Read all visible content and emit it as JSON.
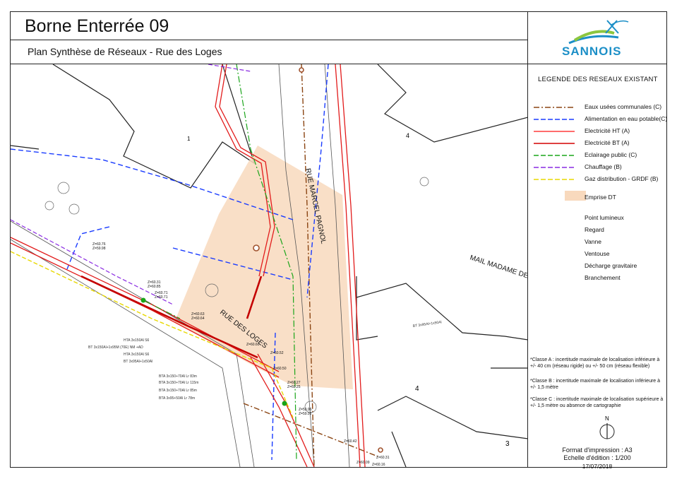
{
  "header": {
    "title": "Borne Enterrée 09",
    "subtitle": "Plan Synthèse de Réseaux - Rue des Loges",
    "logo_text": "SANNOIS"
  },
  "legend": {
    "title": "LEGENDE DES RESEAUX EXISTANT",
    "network_items": [
      {
        "label": "Eaux usées communales (C)",
        "color": "#8b4513",
        "style": "dashdot"
      },
      {
        "label": "Alimentation en eau potable(C)",
        "color": "#1a3cff",
        "style": "dash"
      },
      {
        "label": "Electricité HT (A)",
        "color": "#ff3b3b",
        "style": "solid"
      },
      {
        "label": "Electricité BT (A)",
        "color": "#d40000",
        "style": "solid"
      },
      {
        "label": "Eclairage public (C)",
        "color": "#1aa51a",
        "style": "dash"
      },
      {
        "label": "Chauffage (B)",
        "color": "#8a2be2",
        "style": "dash"
      },
      {
        "label": "Gaz distribution - GRDF (B)",
        "color": "#e8d800",
        "style": "dash"
      }
    ],
    "emprise": {
      "label": "Emprise DT",
      "color": "#f8d9bd"
    },
    "symbol_items": [
      {
        "label": "Point lumineux",
        "icon": "green-dot-icon"
      },
      {
        "label": "Regard",
        "icon": "manhole-icon"
      },
      {
        "label": "Vanne",
        "icon": "valve-icon"
      },
      {
        "label": "Ventouse",
        "icon": "air-valve-icon"
      },
      {
        "label": "Décharge gravitaire",
        "icon": "gravity-discharge-icon"
      },
      {
        "label": "Branchement",
        "icon": "connection-arrow-icon"
      }
    ],
    "notes": [
      "*Classe A : incertitude maximale de localisation inférieure à +/- 40 cm (réseau rigide) ou +/- 50 cm (réseau flexible)",
      "*Classe B : incertitude maximale de localisation inférieure à +/- 1,5 mètre",
      "*Classe C : incertitude maximale de localisation supérieure à +/- 1,5 mètre ou absence de cartographie"
    ],
    "north_label": "N",
    "format_line": "Format d'impression : A3",
    "scale_line": "Echelle d'édition : 1/200",
    "date": "17/07/2018"
  },
  "map": {
    "street_marcel": "RUE MARCEL PAGNOL",
    "street_loges": "RUE DES LOGES",
    "street_mail": "MAIL MADAME DE SEV",
    "parcel_numbers": [
      "1",
      "4",
      "4",
      "3"
    ],
    "cable_labels": [
      "HTA 3x150Al S6",
      "BT 3x150Al+1x95M (70E) NM +AD",
      "HTA 3x150Al S6",
      "BT 3x95Al+1x50Al",
      "BTA 3x150+70Al Lr 83m",
      "BTA 3x150+70Al Lr 115m",
      "BTA 3x150+70Al Lr 85m",
      "BTA 3x95+50Al Lr 78m",
      "BT 3x95Al+1x50Al"
    ],
    "spot_levels": [
      "Z=60.76",
      "Z=59.98",
      "Z=60.31",
      "Z=60.85",
      "Z=60.71",
      "Z=60.71",
      "Z=60.63",
      "Z=60.64",
      "Z=60.60",
      "Z=60.52",
      "Z=60.50",
      "Z=60.27",
      "Z=60.25",
      "Z=59.96",
      "Z=59.92",
      "Z=60.42",
      "Z=60.31",
      "Z=60.09",
      "Z=60.16"
    ]
  }
}
